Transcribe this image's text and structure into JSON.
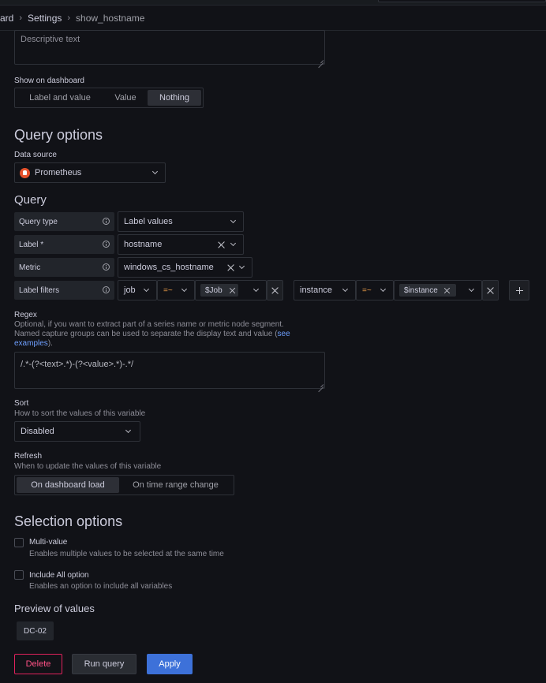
{
  "breadcrumbs": {
    "items": [
      "ard",
      "Settings",
      "show_hostname"
    ],
    "separator": "›"
  },
  "description": {
    "value": "Descriptive text"
  },
  "show_on_dashboard": {
    "label": "Show on dashboard",
    "options": [
      "Label and value",
      "Value",
      "Nothing"
    ],
    "selected": "Nothing"
  },
  "query_options": {
    "title": "Query options",
    "data_source_label": "Data source",
    "data_source": "Prometheus",
    "data_source_icon": "prometheus-logo-icon",
    "query_title": "Query",
    "query_type_label": "Query type",
    "query_type": "Label values",
    "label_label": "Label *",
    "label_value": "hostname",
    "metric_label": "Metric",
    "metric_value": "windows_cs_hostname",
    "label_filters_label": "Label filters",
    "filters": [
      {
        "label": "job",
        "operator": "=~",
        "value": "$Job"
      },
      {
        "label": "instance",
        "operator": "=~",
        "value": "$instance"
      }
    ]
  },
  "regex": {
    "label": "Regex",
    "desc_line1": "Optional, if you want to extract part of a series name or metric node segment.",
    "desc_line2": "Named capture groups can be used to separate the display text and value (",
    "desc_link_part1": "see",
    "desc_link_part2": "examples",
    "desc_end": ").",
    "value": "/.*-(?<text>.*)-(?<value>.*)-.*/"
  },
  "sort": {
    "label": "Sort",
    "description": "How to sort the values of this variable",
    "value": "Disabled"
  },
  "refresh": {
    "label": "Refresh",
    "description": "When to update the values of this variable",
    "options": [
      "On dashboard load",
      "On time range change"
    ],
    "selected": "On dashboard load"
  },
  "selection_options": {
    "title": "Selection options",
    "multi_value_label": "Multi-value",
    "multi_value_desc": "Enables multiple values to be selected at the same time",
    "include_all_label": "Include All option",
    "include_all_desc": "Enables an option to include all variables",
    "multi_value_checked": false,
    "include_all_checked": false
  },
  "preview": {
    "title": "Preview of values",
    "values": [
      "DC-02"
    ]
  },
  "actions": {
    "delete": "Delete",
    "run_query": "Run query",
    "apply": "Apply"
  },
  "colors": {
    "background": "#111217",
    "primary": "#3d71d9",
    "danger": "#e0225c",
    "operator": "#f5a14b",
    "link": "#6e9fff"
  }
}
